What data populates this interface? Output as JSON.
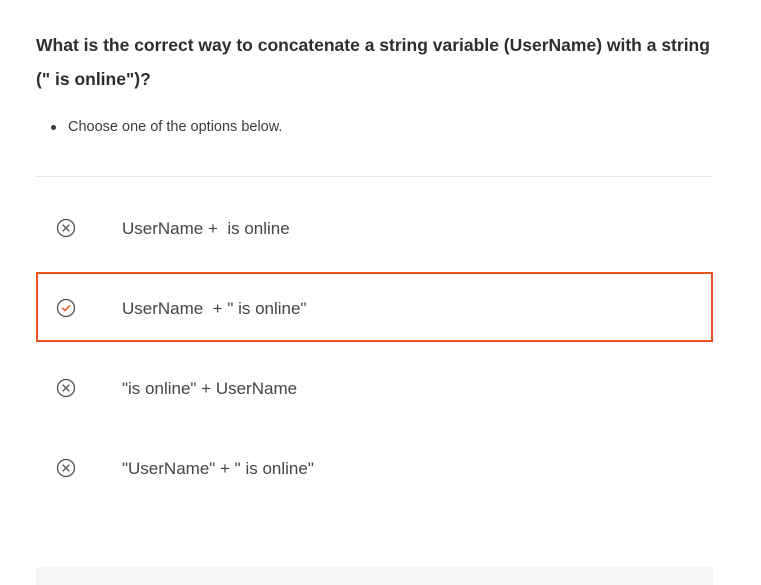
{
  "question": {
    "text": "What is the correct way to concatenate a string variable (UserName) with a string (\" is online\")?"
  },
  "instructions": [
    "Choose one of the options below."
  ],
  "options": [
    {
      "label": "UserName +  is online",
      "status": "incorrect",
      "icon": "x-circle-icon"
    },
    {
      "label": "UserName  + \" is online\"",
      "status": "correct",
      "icon": "check-circle-icon",
      "selected": true
    },
    {
      "label": "\"is online\" + UserName",
      "status": "incorrect",
      "icon": "x-circle-icon"
    },
    {
      "label": "\"UserName\" + \" is online\"",
      "status": "incorrect",
      "icon": "x-circle-icon"
    }
  ],
  "colors": {
    "accent": "#e8531f",
    "icon_stroke": "#555555",
    "divider": "#e8e8e8"
  }
}
